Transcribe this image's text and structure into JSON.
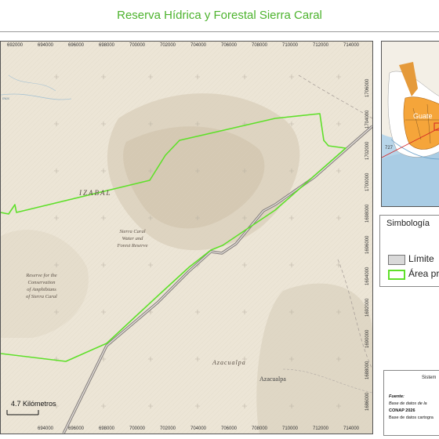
{
  "map": {
    "title": "Reserva Hídrica y Forestal Sierra Caral",
    "x_ticks": [
      "692000",
      "694000",
      "696000",
      "698000",
      "700000",
      "702000",
      "704000",
      "706000",
      "708000",
      "710000",
      "712000",
      "714000"
    ],
    "y_ticks": [
      "1706000",
      "1704000",
      "1702000",
      "1700000",
      "1698000",
      "1696000",
      "1694000",
      "1692000",
      "1690000",
      "1688000",
      "1686000"
    ],
    "labels": {
      "izabal": "IZABAL",
      "sierra_caral": [
        "Sierra Caral",
        "Water and",
        "Forest Reserve"
      ],
      "reserve_amphibians": [
        "Reserve for the",
        "Conservation",
        "of Amphibians",
        "of Sierra Caral"
      ],
      "azacualpa_1": "Azacualpa",
      "azacualpa_2": "Azacualpa",
      "top_left": "mas"
    },
    "scale_label": "4.7 Kilómetros",
    "colors": {
      "area_outline": "#5fe02a",
      "title": "#4db32e",
      "road": "#8b8582",
      "terrain": "#ece5d6"
    }
  },
  "inset": {
    "label_country": "Guate",
    "label_num": "727"
  },
  "legend": {
    "title": "Simbología",
    "items": [
      {
        "label": "Límite",
        "swatch": "#d9d9d9"
      },
      {
        "label": "Área pr",
        "swatch": "#5fe02a"
      }
    ]
  },
  "info": {
    "system": "Sistem",
    "source_title": "Fuente:",
    "lines": [
      "Base de datos de la",
      "CONAP 2026",
      "Base de datos cartogra"
    ]
  }
}
